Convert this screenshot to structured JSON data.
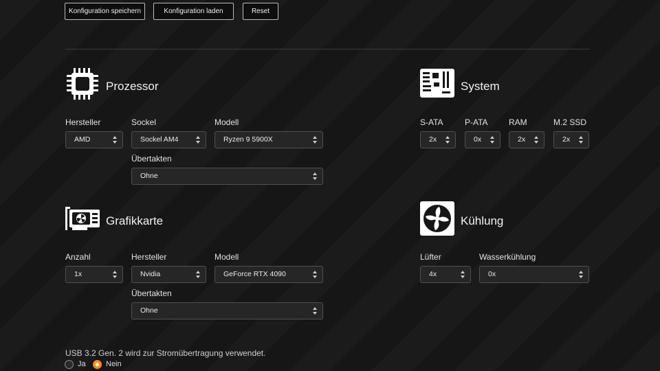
{
  "toolbar": {
    "save": "Konfiguration speichern",
    "load": "Konfiguration laden",
    "reset": "Reset"
  },
  "processor": {
    "title": "Prozessor",
    "icon": "cpu-icon",
    "manufacturer_label": "Hersteller",
    "manufacturer": "AMD",
    "socket_label": "Sockel",
    "socket": "Sockel AM4",
    "model_label": "Modell",
    "model": "Ryzen 9 5900X",
    "overclock_label": "Übertakten",
    "overclock": "Ohne"
  },
  "system": {
    "title": "System",
    "icon": "motherboard-icon",
    "sata_label": "S-ATA",
    "sata": "2x",
    "pata_label": "P-ATA",
    "pata": "0x",
    "ram_label": "RAM",
    "ram": "2x",
    "m2_label": "M.2 SSD",
    "m2": "2x"
  },
  "gpu": {
    "title": "Grafikkarte",
    "icon": "graphics-card-icon",
    "count_label": "Anzahl",
    "count": "1x",
    "manufacturer_label": "Hersteller",
    "manufacturer": "Nvidia",
    "model_label": "Modell",
    "model": "GeForce RTX 4090",
    "overclock_label": "Übertakten",
    "overclock": "Ohne"
  },
  "cooling": {
    "title": "Kühlung",
    "icon": "fan-icon",
    "fans_label": "Lüfter",
    "fans": "4x",
    "water_label": "Wasserkühlung",
    "water": "0x"
  },
  "usb": {
    "question": "USB 3.2 Gen. 2 wird zur Stromübertragung verwendet.",
    "yes": "Ja",
    "no": "Nein",
    "selected": "Nein"
  },
  "colors": {
    "accent": "#ff8a1e",
    "background": "#161616"
  }
}
